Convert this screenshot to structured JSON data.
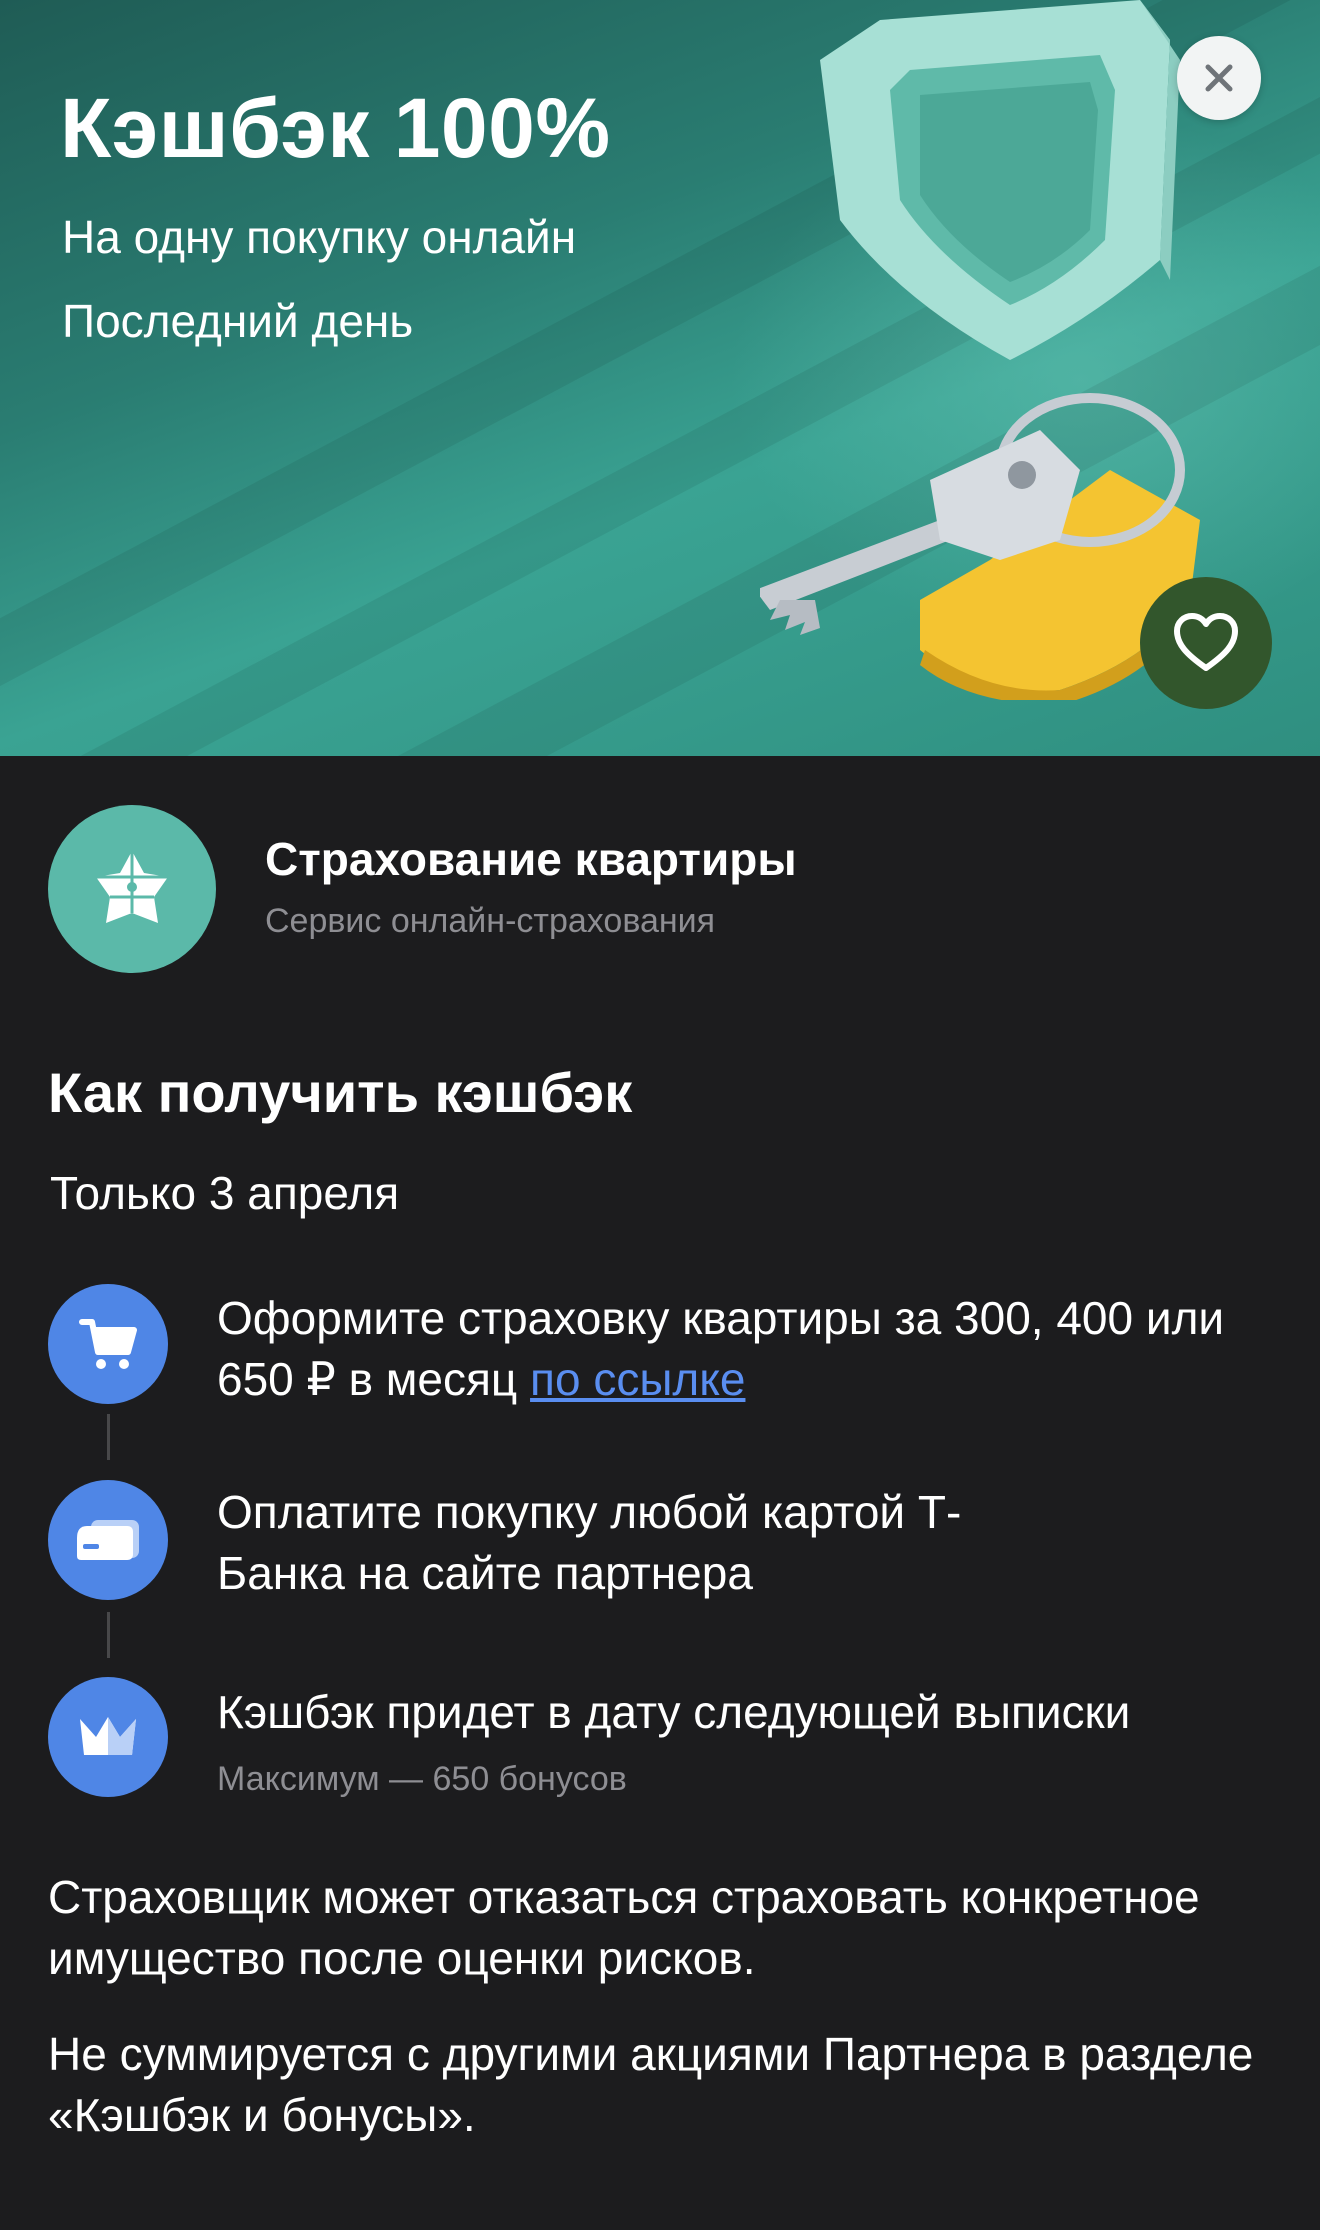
{
  "banner": {
    "title": "Кэшбэк 100%",
    "subtitle": "На одну покупку онлайн",
    "deadline": "Последний день"
  },
  "partner": {
    "name": "Страхование квартиры",
    "description": "Сервис онлайн-страхования"
  },
  "how_to": {
    "title": "Как получить кэшбэк",
    "date": "Только 3 апреля",
    "steps": [
      {
        "text": "Оформите страховку квартиры за 300, 400 или 650 ₽ в месяц",
        "link": "по ссылке",
        "icon": "cart-icon"
      },
      {
        "text": "Оплатите покупку любой картой Т-Банка на сайте партнера",
        "icon": "card-icon"
      },
      {
        "text": "Кэшбэк придет в дату следующей выписки",
        "note": "Максимум — 650 бонусов",
        "icon": "crown-icon"
      }
    ]
  },
  "notes": [
    "Страховщик может отказаться страховать конкретное имущество после оценки рисков.",
    "Не суммируется с другими акциями Партнера в разделе «Кэшбэк и бонусы»."
  ],
  "colors": {
    "background": "#1c1c1e",
    "accent_blue": "#4f86e6",
    "link": "#5a8ef0",
    "partner_logo": "#5bb9a9",
    "favorite_button": "#32562c"
  }
}
